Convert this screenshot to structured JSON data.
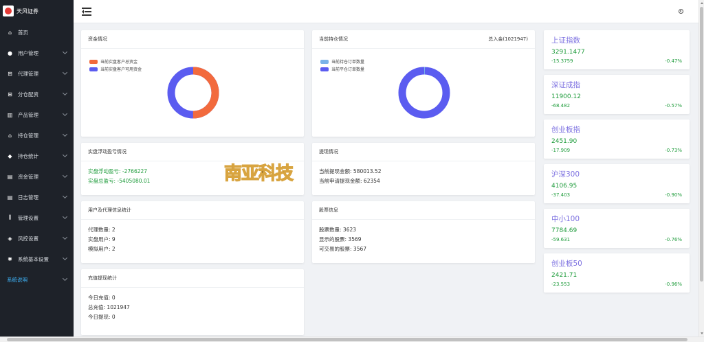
{
  "brand": {
    "name": "天风证券"
  },
  "sidebar": {
    "items": [
      {
        "label": "首页",
        "icon": "home-icon",
        "glyph": "⌂",
        "expandable": false
      },
      {
        "label": "用户管理",
        "icon": "user-icon",
        "glyph": "●",
        "expandable": true
      },
      {
        "label": "代理管理",
        "icon": "org-chart-icon",
        "glyph": "⊞",
        "expandable": true
      },
      {
        "label": "分仓配资",
        "icon": "org-chart-icon",
        "glyph": "⊞",
        "expandable": true
      },
      {
        "label": "产品管理",
        "icon": "bar-chart-icon",
        "glyph": "▥",
        "expandable": true
      },
      {
        "label": "持仓管理",
        "icon": "house-icon",
        "glyph": "⌂",
        "expandable": true
      },
      {
        "label": "持仓统计",
        "icon": "cube-icon",
        "glyph": "◆",
        "expandable": true
      },
      {
        "label": "资金管理",
        "icon": "database-icon",
        "glyph": "▤",
        "expandable": true
      },
      {
        "label": "日志管理",
        "icon": "document-icon",
        "glyph": "▤",
        "expandable": true
      },
      {
        "label": "管理设置",
        "icon": "sliders-icon",
        "glyph": "⫼",
        "expandable": true
      },
      {
        "label": "风控设置",
        "icon": "shield-icon",
        "glyph": "◈",
        "expandable": true
      },
      {
        "label": "系统基本设置",
        "icon": "gear-icon",
        "glyph": "✱",
        "expandable": true
      },
      {
        "label": "系统说明",
        "icon": "",
        "glyph": "",
        "expandable": true,
        "active": true
      }
    ]
  },
  "colors": {
    "orange": "#f26a3d",
    "purple": "#5b5cf0",
    "lightblue": "#7ab3e8",
    "green": "#1f9c3c",
    "index_name": "#7b6fe0"
  },
  "funds": {
    "title": "资金情况",
    "legend": [
      "当前实盘客户总资金",
      "当前实盘客户可用资金"
    ],
    "ratio": 0.5
  },
  "positions": {
    "title": "当前持仓情况",
    "total_label": "总入金(1021947)",
    "legend": [
      "当前持仓订单数量",
      "当前平仓订单数量"
    ],
    "ratio": 0.005
  },
  "pnl": {
    "title": "实盘浮动盈亏情况",
    "float_label": "实盘浮动盈亏:",
    "float_value": "-2766227",
    "total_label": "实盘总盈亏:",
    "total_value": "-5405080.01"
  },
  "withdraw": {
    "title": "提现情况",
    "cur_label": "当前提现金额:",
    "cur_value": "580013.52",
    "apply_label": "当前申请提现金额:",
    "apply_value": "62354"
  },
  "users": {
    "title": "用户及代理信息统计",
    "rows": [
      {
        "label": "代理数量:",
        "value": "2"
      },
      {
        "label": "实盘用户:",
        "value": "9"
      },
      {
        "label": "模拟用户:",
        "value": "2"
      }
    ]
  },
  "stocks": {
    "title": "股票信息",
    "rows": [
      {
        "label": "股票数量:",
        "value": "3623"
      },
      {
        "label": "显示的股票:",
        "value": "3569"
      },
      {
        "label": "可交易的股票:",
        "value": "3567"
      }
    ]
  },
  "recharge": {
    "title": "充值提现统计",
    "rows": [
      {
        "label": "今日充值:",
        "value": "0"
      },
      {
        "label": "总充值:",
        "value": "1021947"
      },
      {
        "label": "今日提现:",
        "value": "0"
      }
    ]
  },
  "watermark": {
    "text": "南亚科技"
  },
  "indices": [
    {
      "name": "上证指数",
      "price": "3291.1477",
      "change": "-15.3759",
      "pct": "-0.47%"
    },
    {
      "name": "深证成指",
      "price": "11900.12",
      "change": "-68.482",
      "pct": "-0.57%"
    },
    {
      "name": "创业板指",
      "price": "2451.90",
      "change": "-17.909",
      "pct": "-0.73%"
    },
    {
      "name": "沪深300",
      "price": "4106.95",
      "change": "-37.403",
      "pct": "-0.90%"
    },
    {
      "name": "中小100",
      "price": "7784.69",
      "change": "-59.631",
      "pct": "-0.76%"
    },
    {
      "name": "创业板50",
      "price": "2421.71",
      "change": "-23.553",
      "pct": "-0.96%"
    }
  ]
}
